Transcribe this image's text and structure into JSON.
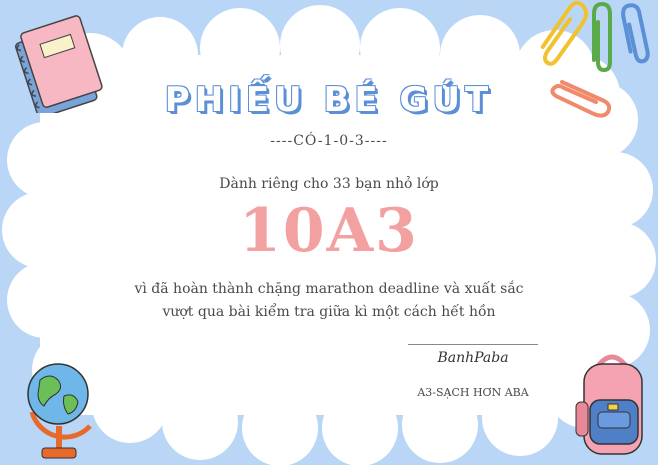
{
  "certificate": {
    "title": "PHIẾU BÉ GÚT",
    "subtitle": "----CÓ-1-0-3----",
    "dedication": "Dành riêng cho 33 bạn nhỏ lớp",
    "class_name": "10A3",
    "body_line1": "vì đã hoàn thành chặng marathon deadline và xuất sắc",
    "body_line2": "vượt qua bài kiểm tra giữa kì một cách hết hồn",
    "signature": "BanhPaba",
    "signer_name": "A3-SẠCH HƠN ABA"
  },
  "colors": {
    "background": "#b9d6f6",
    "card": "#ffffff",
    "title_fill": "#ffffff",
    "title_outline": "#5b8fd6",
    "class_name": "#f2a0a0",
    "body_text": "#4a4a4a"
  },
  "decorations": [
    "notebook-icon",
    "paperclip-icon",
    "globe-icon",
    "backpack-icon"
  ]
}
